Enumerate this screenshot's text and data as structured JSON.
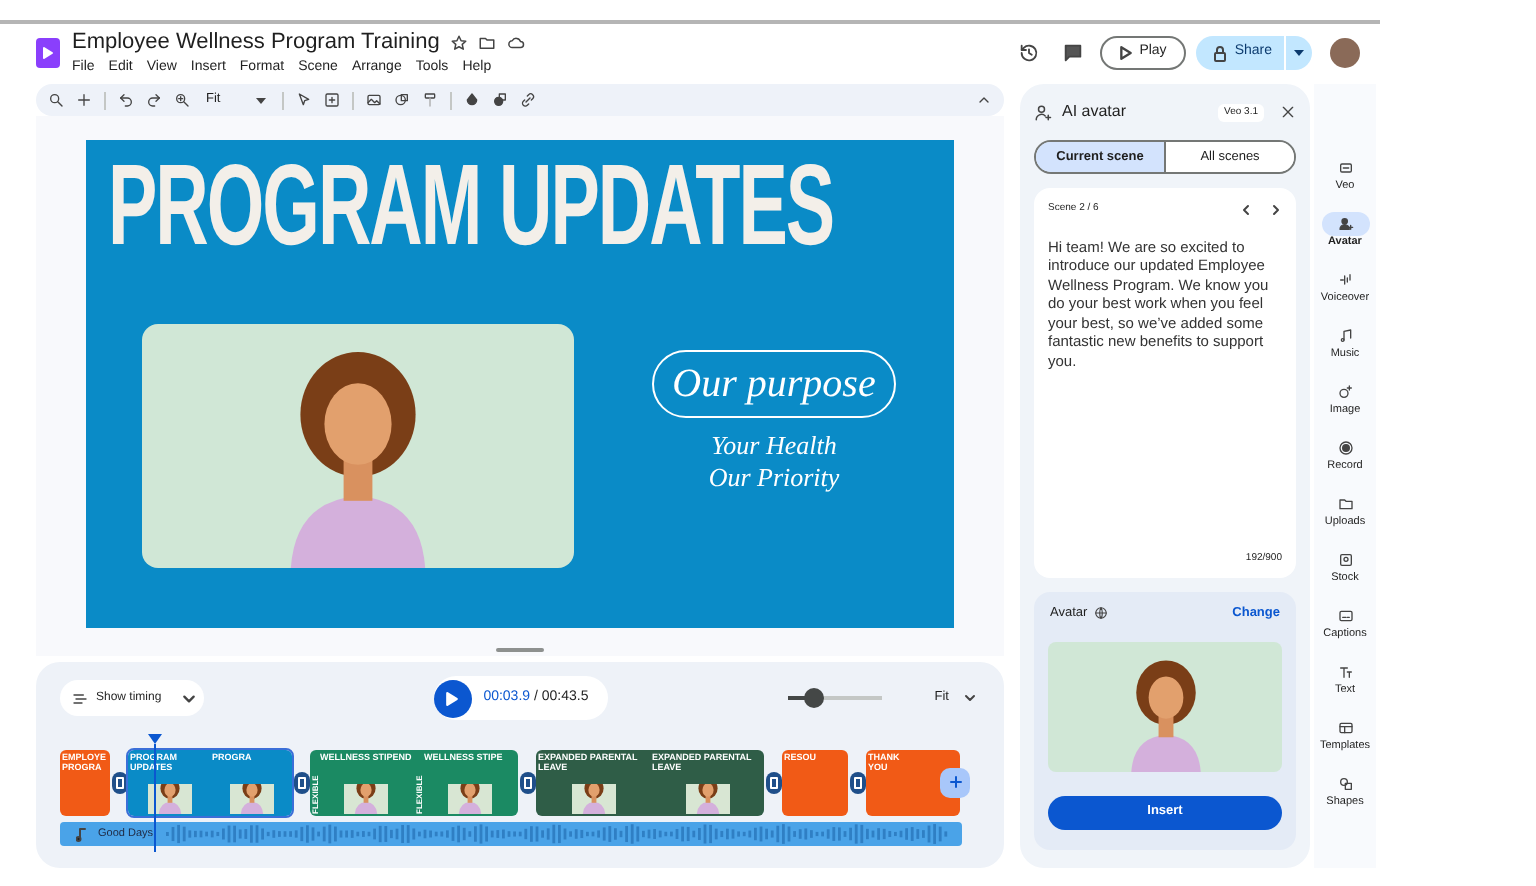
{
  "document": {
    "title": "Employee Wellness Program Training"
  },
  "menu": [
    "File",
    "Edit",
    "View",
    "Insert",
    "Format",
    "Scene",
    "Arrange",
    "Tools",
    "Help"
  ],
  "toolbar": {
    "zoom": "Fit"
  },
  "header": {
    "play": "Play",
    "share": "Share"
  },
  "slide": {
    "title": "PROGRAM UPDATES",
    "pill": "Our purpose",
    "tagline": [
      "Your Health",
      "Our Priority"
    ]
  },
  "timeline": {
    "show_timing": "Show timing",
    "current_time": "00:03.9",
    "total_time": "/ 00:43.5",
    "zoom": {
      "level": 0.28
    },
    "fit": "Fit",
    "audio": "Good Days",
    "scenes": [
      {
        "color": "#f15a16",
        "selected": false,
        "frames": [
          {
            "lines": [
              "EMPLOYE",
              "PROGRA"
            ],
            "avatar": false
          }
        ]
      },
      {
        "color": "#0a8bc7",
        "selected": true,
        "frames": [
          {
            "lines": [
              "PROGRAM UPDATES"
            ],
            "avatar": true
          },
          {
            "lines": [
              "PROGRA"
            ],
            "avatar": true
          }
        ]
      },
      {
        "color": "#1b8a63",
        "selected": false,
        "frames": [
          {
            "side": "FLEXIBLE",
            "lines": [
              "WELLNESS STIPEND"
            ],
            "avatar": true
          },
          {
            "side": "FLEXIBLE",
            "lines": [
              "WELLNESS STIPE"
            ],
            "avatar": true
          }
        ]
      },
      {
        "color": "#2f5d47",
        "selected": false,
        "frames": [
          {
            "lines": [
              "EXPANDED PARENTAL LEAVE"
            ],
            "avatar": true
          },
          {
            "lines": [
              "EXPANDED PARENTAL LEAVE"
            ],
            "avatar": true
          }
        ]
      },
      {
        "color": "#f15a16",
        "selected": false,
        "frames": [
          {
            "lines": [
              "RESOU"
            ],
            "avatar": false
          }
        ]
      },
      {
        "color": "#f15a16",
        "selected": false,
        "frames": [
          {
            "lines": [
              "THANK",
              "YOU"
            ],
            "avatar": false
          }
        ]
      }
    ]
  },
  "panel": {
    "title": "AI avatar",
    "badge": "Veo 3.1",
    "tabs": [
      {
        "label": "Current scene",
        "selected": true
      },
      {
        "label": "All scenes",
        "selected": false
      }
    ],
    "scene": "Scene 2 / 6",
    "script": "Hi team! We are so excited to introduce our updated Employee Wellness Program. We know you do your best work when you feel your best, so we’ve added some fantastic new benefits to support you.",
    "count": "192/900",
    "avatar_label": "Avatar",
    "change": "Change",
    "insert": "Insert"
  },
  "rail": [
    {
      "label": "Veo",
      "selected": false
    },
    {
      "label": "Avatar",
      "selected": true
    },
    {
      "label": "Voiceover",
      "selected": false
    },
    {
      "label": "Music",
      "selected": false
    },
    {
      "label": "Image",
      "selected": false
    },
    {
      "label": "Record",
      "selected": false
    },
    {
      "label": "Uploads",
      "selected": false
    },
    {
      "label": "Stock",
      "selected": false
    },
    {
      "label": "Captions",
      "selected": false
    },
    {
      "label": "Text",
      "selected": false
    },
    {
      "label": "Templates",
      "selected": false
    },
    {
      "label": "Shapes",
      "selected": false
    }
  ]
}
